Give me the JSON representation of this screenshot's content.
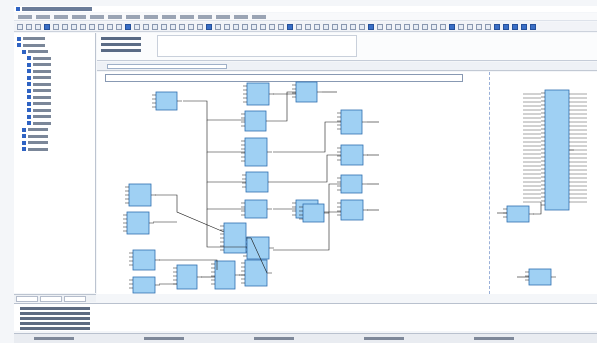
{
  "window": {
    "title": ""
  },
  "menu": {
    "items": [
      "",
      "",
      "",
      "",
      "",
      "",
      "",
      "",
      "",
      "",
      "",
      "",
      "",
      ""
    ]
  },
  "tree": {
    "nodes": [
      {
        "label": "",
        "level": 0
      },
      {
        "label": "",
        "level": 0
      },
      {
        "label": "",
        "level": 1
      },
      {
        "label": "",
        "level": 2
      },
      {
        "label": "",
        "level": 2
      },
      {
        "label": "",
        "level": 2
      },
      {
        "label": "",
        "level": 2
      },
      {
        "label": "",
        "level": 2
      },
      {
        "label": "",
        "level": 2
      },
      {
        "label": "",
        "level": 2
      },
      {
        "label": "",
        "level": 2
      },
      {
        "label": "",
        "level": 2
      },
      {
        "label": "",
        "level": 2
      },
      {
        "label": "",
        "level": 2
      },
      {
        "label": "",
        "level": 1
      },
      {
        "label": "",
        "level": 1
      },
      {
        "label": "",
        "level": 1
      },
      {
        "label": "",
        "level": 1
      }
    ]
  },
  "tree_tabs": [
    "",
    "",
    ""
  ],
  "properties": {
    "rows": [
      "",
      "",
      ""
    ]
  },
  "document": {
    "tab": "",
    "page_label": ""
  },
  "output": {
    "lines": [
      "",
      "",
      "",
      "",
      ""
    ]
  },
  "statusbar": {
    "items": [
      "",
      "",
      "",
      "",
      ""
    ]
  },
  "colors": {
    "block_fill": "#9fd0f3",
    "block_stroke": "#2f6fb0",
    "wire": "#1a1a1a",
    "accent": "#2f63c3"
  }
}
